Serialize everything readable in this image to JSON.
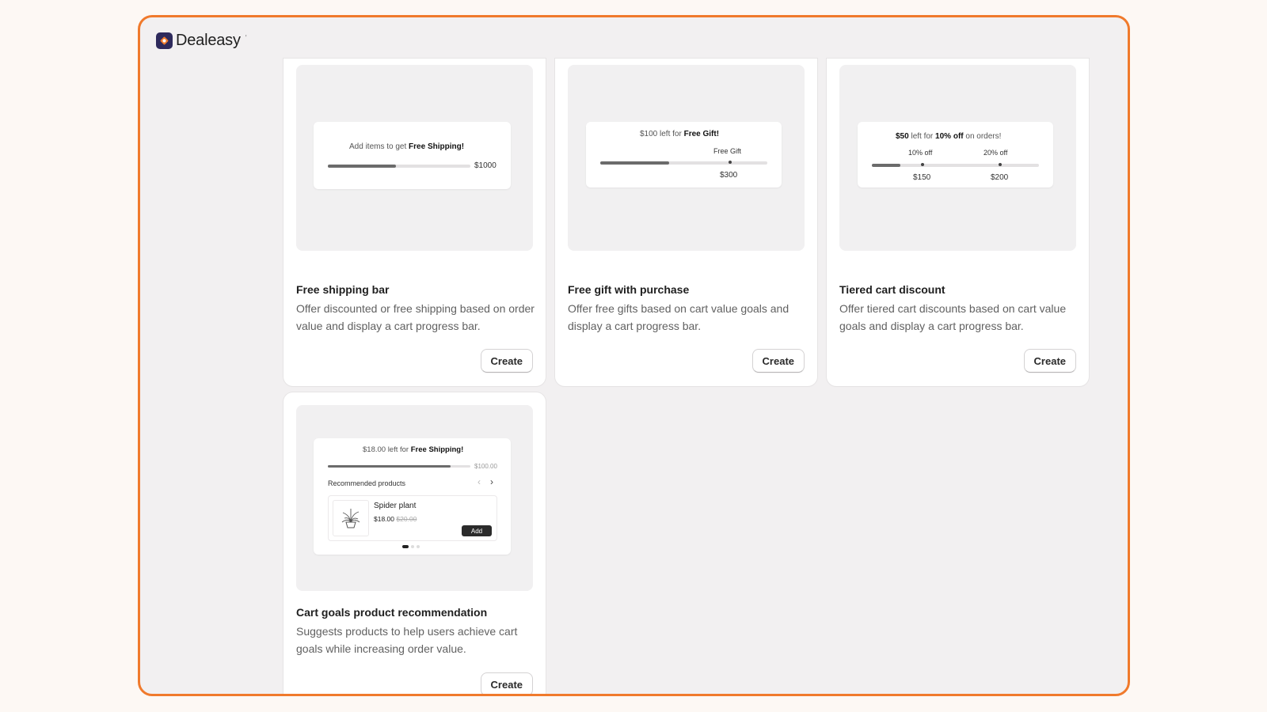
{
  "app": {
    "name": "Dealeasy",
    "name_suffix": "'"
  },
  "cards": [
    {
      "title": "Free shipping bar",
      "description": "Offer discounted or free shipping based on order value and display a cart progress bar.",
      "button": "Create",
      "preview": {
        "message_prefix": "Add items to get ",
        "message_bold": "Free Shipping!",
        "goal": "$1000",
        "progress": 0.48
      }
    },
    {
      "title": "Free gift with purchase",
      "description": "Offer free gifts based on cart value goals and display a cart progress bar.",
      "button": "Create",
      "preview": {
        "message_prefix": "$100 left for ",
        "message_bold": "Free Gift!",
        "milestone_label": "Free Gift",
        "milestone_value": "$300",
        "progress": 0.41
      }
    },
    {
      "title": "Tiered cart discount",
      "description": "Offer tiered cart discounts based on cart value goals and display a cart progress bar.",
      "button": "Create",
      "preview": {
        "message_bold_amount": "$50",
        "message_mid": " left for ",
        "message_bold": "10% off",
        "message_suffix": " on orders!",
        "tier1_label": "10% off",
        "tier1_value": "$150",
        "tier2_label": "20% off",
        "tier2_value": "$200",
        "progress": 0.17
      }
    },
    {
      "title": "Cart goals product recommendation",
      "description": "Suggests products to help users achieve cart goals while increasing order value.",
      "button": "Create",
      "preview": {
        "message_prefix": "$18.00 left for ",
        "message_bold": "Free Shipping!",
        "goal": "$100.00",
        "progress": 0.86,
        "recommended_label": "Recommended products",
        "product": {
          "name": "Spider plant",
          "price": "$18.00",
          "compare_price": "$20.00",
          "add_label": "Add"
        }
      }
    }
  ],
  "icons": {
    "logo": "dealeasy-logo-icon",
    "prev": "chevron-left-icon",
    "next": "chevron-right-icon",
    "plant": "plant-icon"
  },
  "colors": {
    "frame_border": "#f07a2c",
    "logo_bg": "#2e2a5c",
    "bar_fill": "#6b6b6b"
  }
}
